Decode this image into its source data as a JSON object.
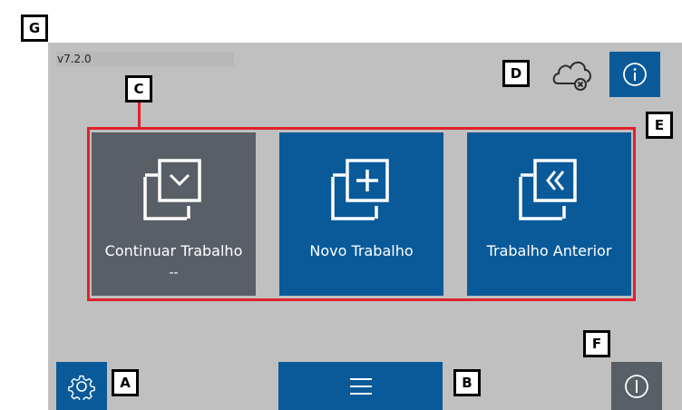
{
  "version": "v7.2.0",
  "tiles": [
    {
      "label": "Continuar Trabalho",
      "sub": "--"
    },
    {
      "label": "Novo Trabalho",
      "sub": ""
    },
    {
      "label": "Trabalho Anterior",
      "sub": ""
    }
  ],
  "callouts": {
    "a": "A",
    "b": "B",
    "c": "C",
    "d": "D",
    "e": "E",
    "f": "F",
    "g": "G"
  },
  "colors": {
    "blue": "#0a5a9a",
    "gray": "#595f66",
    "red": "#e0212b",
    "screen": "#c0c0c0"
  },
  "icons": [
    "cloud-offline-icon",
    "info-icon",
    "gear-icon",
    "menu-icon",
    "power-icon",
    "continue-job-icon",
    "new-job-icon",
    "previous-job-icon"
  ]
}
